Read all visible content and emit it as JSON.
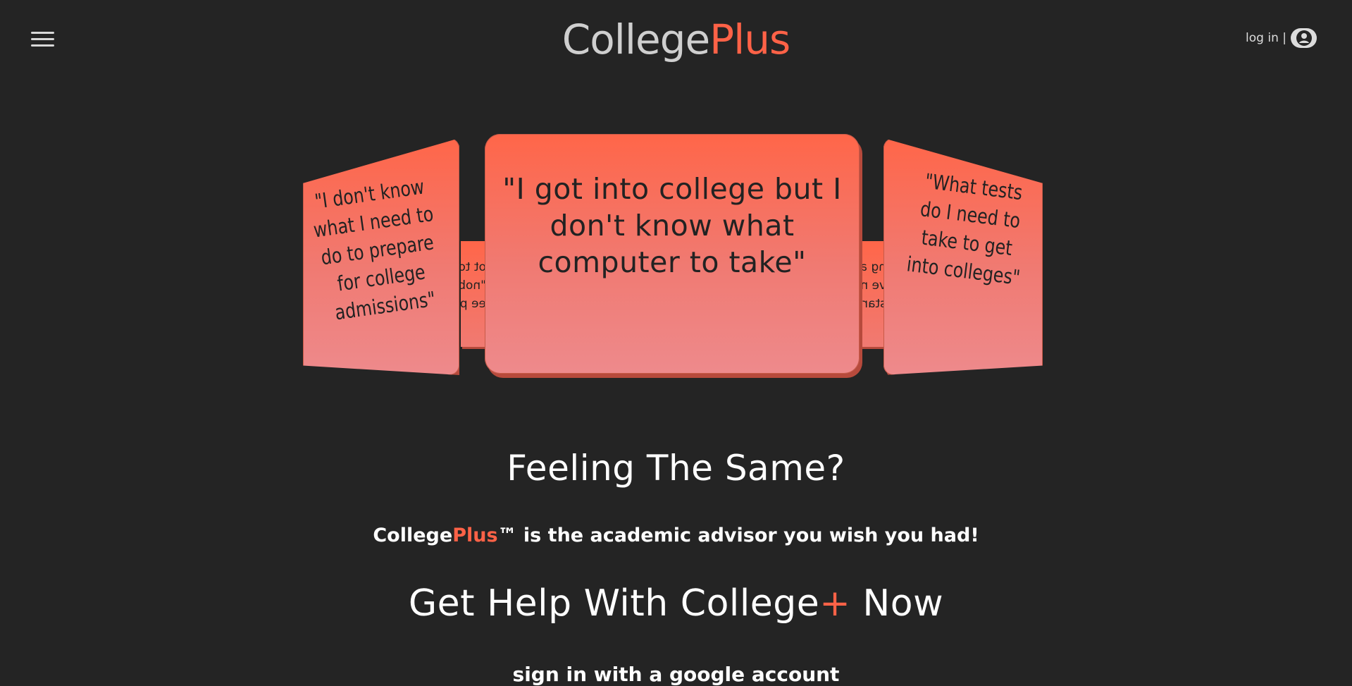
{
  "header": {
    "logo_main": "College",
    "logo_accent": "Plus",
    "login_label": "log in |"
  },
  "carousel": {
    "center_quote": "\"I got into college but I don't know what computer to take\"",
    "left_quote": "\"I don't know what I need to do to prepare for college admissions\"",
    "right_quote": "\"What tests do I need to take to get into colleges\"",
    "back_left_snippet": "ot to\n\"nob'\nee pa",
    "back_right_snippet": "ng ab\nve no\nstart"
  },
  "main": {
    "feeling_heading": "Feeling The Same?",
    "tagline_brand": "College",
    "tagline_brand_accent": "Plus",
    "tagline_rest": "™ is the academic advisor you wish you had!",
    "gethelp_before": "Get Help With College",
    "gethelp_plus": "+",
    "gethelp_after": " Now",
    "signin_label": "sign in with a google account"
  },
  "colors": {
    "background": "#242424",
    "accent": "#ff6247",
    "card_gradient_top": "#ff6649",
    "card_gradient_bottom": "#ee8a8c"
  },
  "icons": [
    "hamburger-menu-icon",
    "user-circle-icon"
  ]
}
